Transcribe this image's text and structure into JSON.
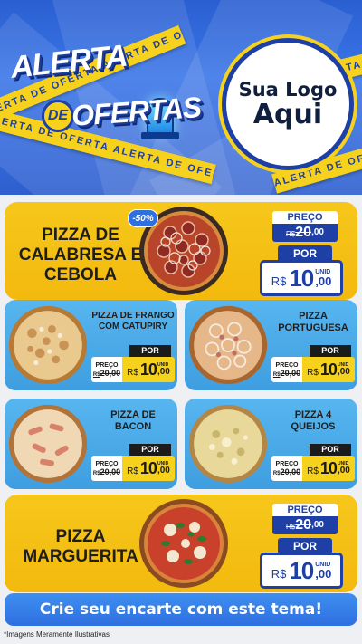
{
  "header": {
    "title_line1": "ALERTA",
    "title_de": "DE",
    "title_line2": "OFERTAS",
    "tape_text": "ALERTA DE OFERTA ALERTA DE OFERTA",
    "logo_line1": "Sua Logo",
    "logo_line2": "Aqui"
  },
  "colors": {
    "brand_blue": "#1d3fa6",
    "accent_yellow": "#f7d21c",
    "card_blue": "#4aa9ea"
  },
  "featured": [
    {
      "name": "PIZZA DE CALABRESA E CEBOLA",
      "badge": "-50%",
      "preco_label": "PREÇO",
      "old_currency": "R$",
      "old_value": "20",
      "old_cents": ",00",
      "por_label": "POR",
      "new_currency": "R$",
      "new_value": "10",
      "new_cents": ",00",
      "unit": "UNID",
      "image_icon": "pizza-calabresa-icon"
    },
    {
      "name": "PIZZA MARGUERITA",
      "preco_label": "PREÇO",
      "old_currency": "R$",
      "old_value": "20",
      "old_cents": ",00",
      "por_label": "POR",
      "new_currency": "R$",
      "new_value": "10",
      "new_cents": ",00",
      "unit": "UNID",
      "image_icon": "pizza-marguerita-icon"
    }
  ],
  "products": [
    {
      "name": "PIZZA DE FRANGO COM CATUPIRY",
      "por_label": "POR",
      "preco_label": "PREÇO",
      "old_price": "20,00",
      "old_currency": "R$",
      "new_currency": "R$",
      "new_value": "10",
      "new_cents": ",00",
      "unit": "UNID",
      "image_icon": "pizza-frango-icon"
    },
    {
      "name": "PIZZA PORTUGUESA",
      "por_label": "POR",
      "preco_label": "PREÇO",
      "old_price": "20,00",
      "old_currency": "R$",
      "new_currency": "R$",
      "new_value": "10",
      "new_cents": ",00",
      "unit": "UNID",
      "image_icon": "pizza-portuguesa-icon"
    },
    {
      "name": "PIZZA DE BACON",
      "por_label": "POR",
      "preco_label": "PREÇO",
      "old_price": "20,00",
      "old_currency": "R$",
      "new_currency": "R$",
      "new_value": "10",
      "new_cents": ",00",
      "unit": "UNID",
      "image_icon": "pizza-bacon-icon"
    },
    {
      "name": "PIZZA 4 QUEIJOS",
      "por_label": "POR",
      "preco_label": "PREÇO",
      "old_price": "20,00",
      "old_currency": "R$",
      "new_currency": "R$",
      "new_value": "10",
      "new_cents": ",00",
      "unit": "UNID",
      "image_icon": "pizza-4-queijos-icon"
    }
  ],
  "cta": "Crie seu encarte com este tema!",
  "footnote": "*Imagens Meramente Ilustrativas"
}
